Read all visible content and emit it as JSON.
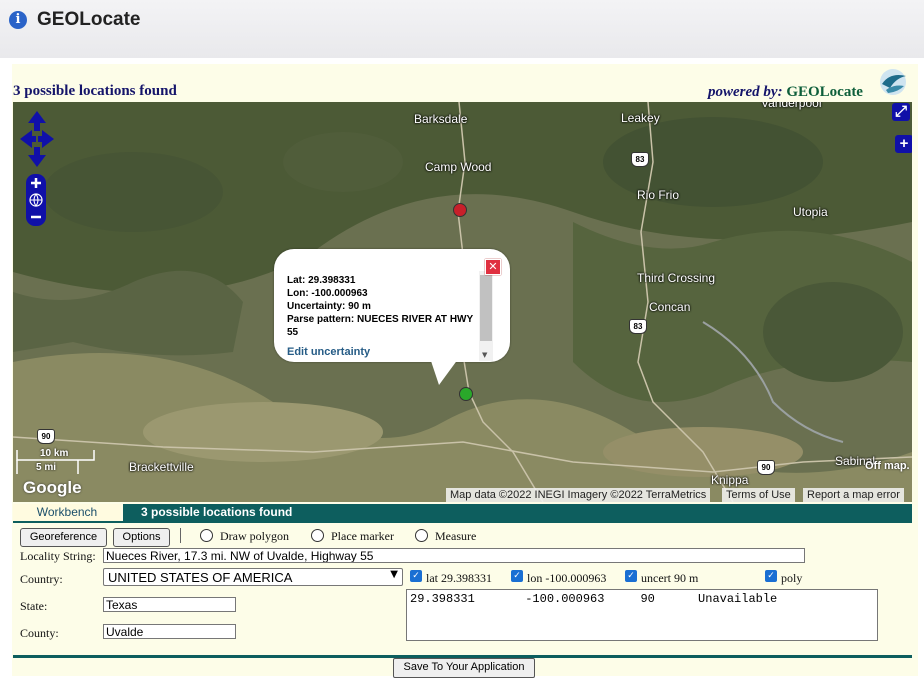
{
  "header": {
    "icon": "info-icon",
    "title": "GEOLocate"
  },
  "results_title": "3 possible locations found",
  "powered": {
    "prefix": "powered by:",
    "brand": "GEOLocate"
  },
  "map": {
    "places": {
      "barksdale": "Barksdale",
      "leakey": "Leakey",
      "vanderpool": "Vanderpool",
      "camp_wood": "Camp Wood",
      "rio_frio": "Rio Frio",
      "utopia": "Utopia",
      "third_crossing": "Third Crossing",
      "concan": "Concan",
      "brackettville": "Brackettville",
      "knippa": "Knippa",
      "sabinal": "Sabinal"
    },
    "shields": {
      "s83a": "83",
      "s83b": "83",
      "s90a": "90",
      "s90b": "90"
    },
    "popup": {
      "lat": "Lat: 29.398331",
      "lon": "Lon: -100.000963",
      "uncertainty": "Uncertainty: 90 m",
      "parse": "Parse pattern: NUECES RIVER AT HWY 55",
      "link": "Edit uncertainty"
    },
    "scale": {
      "km": "10 km",
      "mi": "5 mi"
    },
    "google": "Google",
    "off_map": "Off map.",
    "attribution": {
      "data": "Map data ©2022 INEGI Imagery ©2022 TerraMetrics",
      "terms": "Terms of Use",
      "report": "Report a map error"
    },
    "colors": {
      "red_marker": "#c8202a",
      "green_marker": "#2aa82a"
    }
  },
  "tabs": {
    "workbench": "Workbench",
    "found": "3 possible locations found"
  },
  "toolbar": {
    "georeference": "Georeference",
    "options": "Options",
    "draw_polygon": "Draw polygon",
    "place_marker": "Place marker",
    "measure": "Measure"
  },
  "form": {
    "locality_label": "Locality String:",
    "locality_value": "Nueces River, 17.3 mi. NW of Uvalde, Highway 55",
    "country_label": "Country:",
    "country_value": "UNITED STATES OF AMERICA",
    "state_label": "State:",
    "state_value": "Texas",
    "county_label": "County:",
    "county_value": "Uvalde",
    "lat_check": "lat 29.398331",
    "lon_check": "lon -100.000963",
    "uncert_check": "uncert 90 m",
    "poly_check": "poly",
    "result_text": "29.398331       -100.000963     90      Unavailable"
  },
  "save_button": "Save To Your Application"
}
